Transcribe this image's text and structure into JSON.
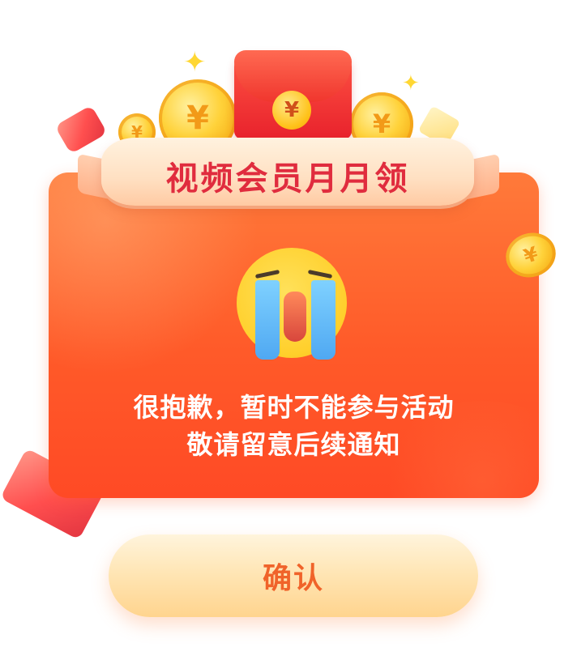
{
  "dialog": {
    "title": "视频会员月月领",
    "message_line1": "很抱歉，暂时不能参与活动",
    "message_line2": "敬请留意后续通知",
    "confirm_label": "确认"
  },
  "decorations": {
    "coin_symbol": "¥",
    "sparkle_symbol": "✦",
    "emoji": "crying-face",
    "colors": {
      "card_orange": "#ff5a29",
      "title_red": "#e02c3e",
      "button_text": "#f0632a",
      "coin_gold": "#ffd23a"
    }
  }
}
